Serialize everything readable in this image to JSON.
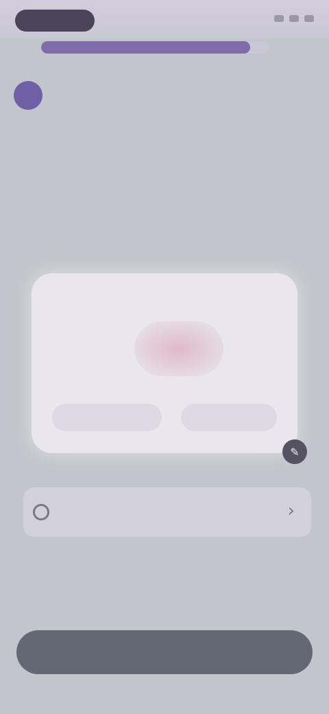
{
  "status_bar": {
    "time": "",
    "icons": [
      "signal-icon",
      "wifi-icon",
      "battery-icon"
    ]
  },
  "progress": {
    "fraction": 0.92
  },
  "header": {
    "subtitle": "",
    "headline": ""
  },
  "main": {
    "caption": "",
    "card": {
      "title": "",
      "body": "",
      "primary_action": "",
      "secondary_action": ""
    },
    "list_item": {
      "label": "",
      "icon": "circle-icon",
      "chevron": "›"
    }
  },
  "footer": {
    "button_label": ""
  },
  "colors": {
    "accent": "#7e6da8",
    "button": "#636874",
    "background": "#c2c5cb"
  }
}
